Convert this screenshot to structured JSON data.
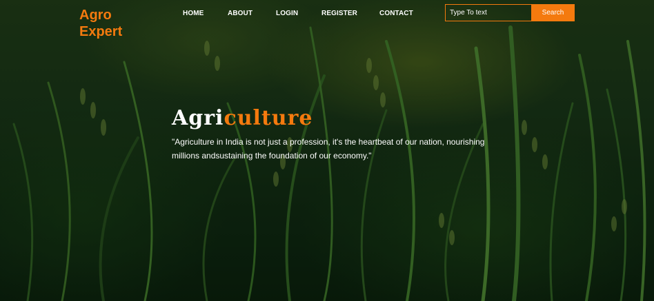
{
  "brand": {
    "line1": "Agro",
    "line2": "Expert",
    "color": "#f47a0e"
  },
  "nav": {
    "home": "HOME",
    "about": "ABOUT",
    "login": "LOGIN",
    "register": "REGISTER",
    "contact": "CONTACT"
  },
  "search": {
    "placeholder": "Type To text",
    "button_label": "Search"
  },
  "hero": {
    "title_part1": "Agri",
    "title_part2": "culture",
    "quote": "\"Agriculture in India is not just a profession, it's the heartbeat of our nation, nourishing millions andsustaining the foundation of our economy.\""
  },
  "colors": {
    "accent": "#f47a0e",
    "text": "#ffffff",
    "background": "#183316"
  },
  "background_image": "rice-field-photo"
}
